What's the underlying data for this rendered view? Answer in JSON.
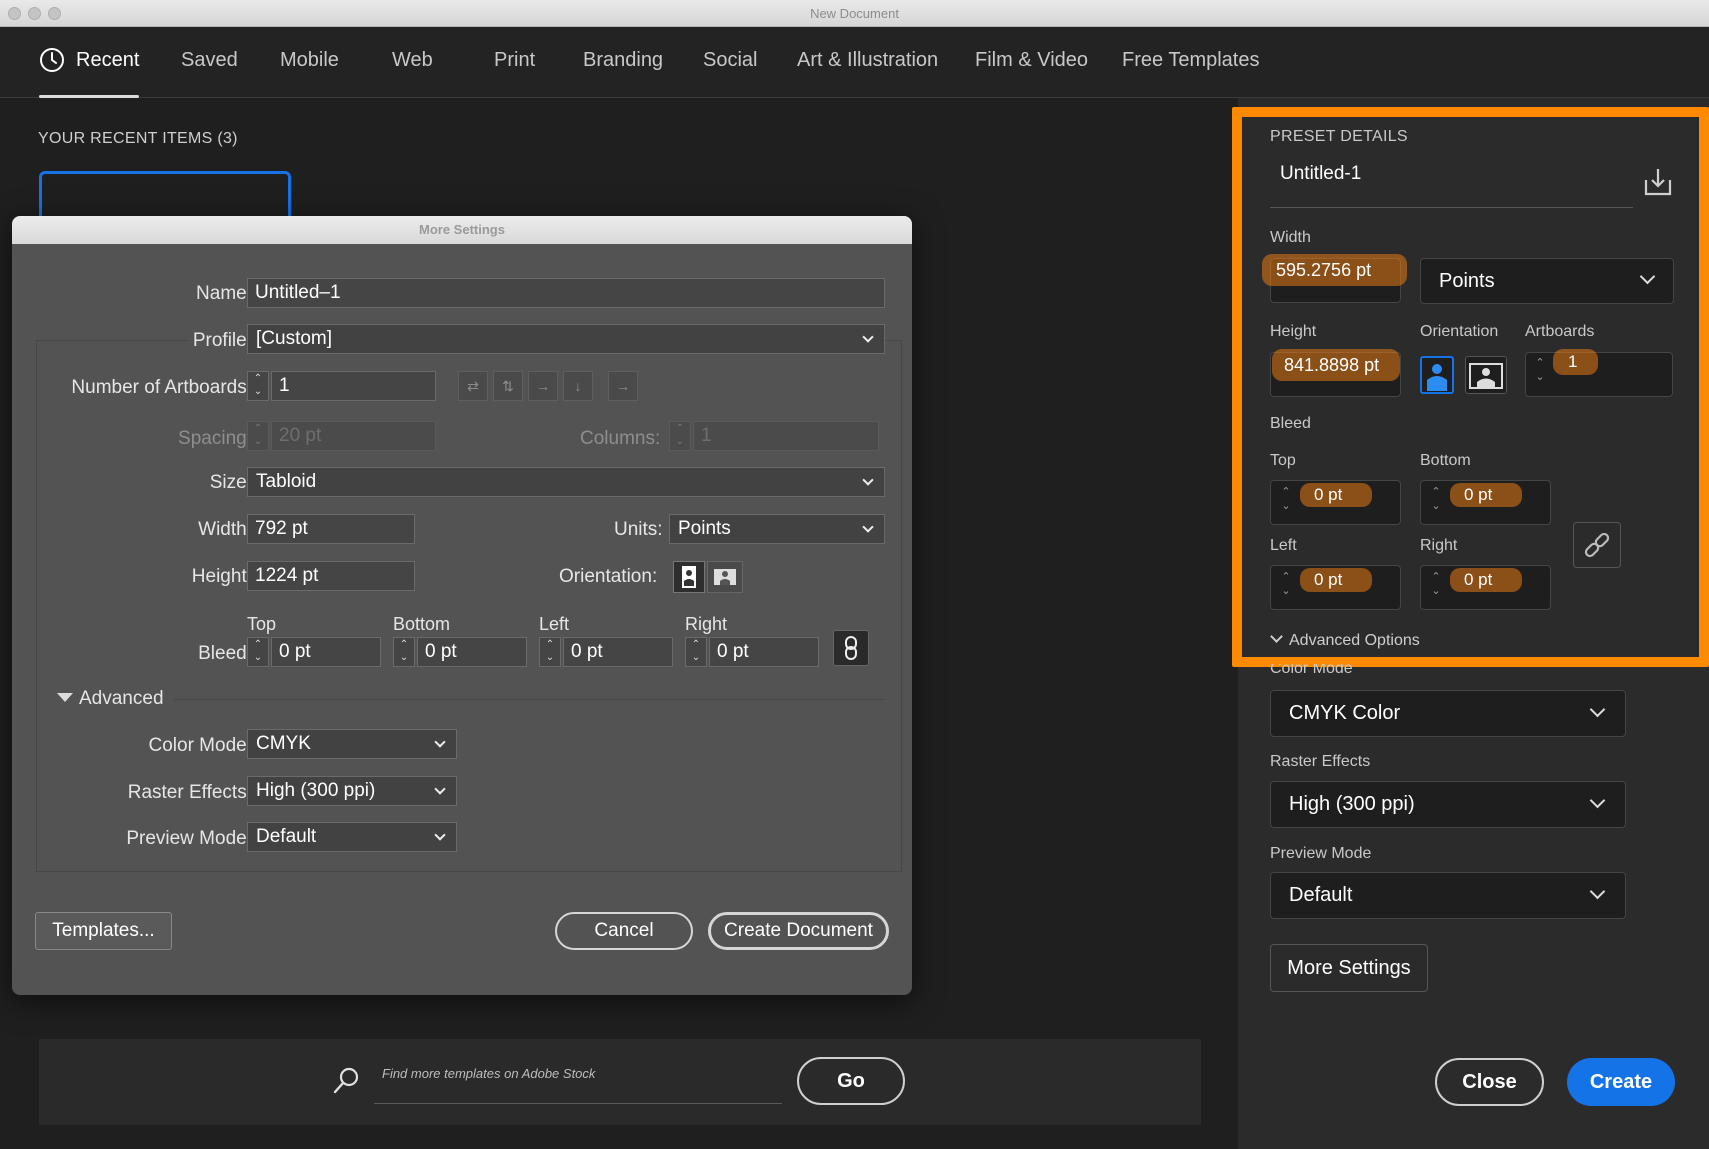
{
  "window": {
    "title": "New Document"
  },
  "tabs": [
    {
      "label": "Recent",
      "icon": "clock-icon"
    },
    {
      "label": "Saved"
    },
    {
      "label": "Mobile"
    },
    {
      "label": "Web"
    },
    {
      "label": "Print"
    },
    {
      "label": "Branding"
    },
    {
      "label": "Social"
    },
    {
      "label": "Art & Illustration"
    },
    {
      "label": "Film & Video"
    },
    {
      "label": "Free Templates"
    }
  ],
  "recent": {
    "heading": "YOUR RECENT ITEMS",
    "count": "(3)"
  },
  "stock": {
    "placeholder": "Find more templates on Adobe Stock",
    "go_label": "Go"
  },
  "preset": {
    "heading": "PRESET DETAILS",
    "name": "Untitled-1",
    "width_label": "Width",
    "width_value": "595.2756 pt",
    "units_value": "Points",
    "height_label": "Height",
    "height_value": "841.8898 pt",
    "orientation_label": "Orientation",
    "artboards_label": "Artboards",
    "artboards_value": "1",
    "bleed_label": "Bleed",
    "top_label": "Top",
    "top_value": "0 pt",
    "bottom_label": "Bottom",
    "bottom_value": "0 pt",
    "left_label": "Left",
    "left_value": "0 pt",
    "right_label": "Right",
    "right_value": "0 pt",
    "advanced_label": "Advanced Options",
    "color_mode_label": "Color Mode",
    "color_mode_value": "CMYK Color",
    "raster_label": "Raster Effects",
    "raster_value": "High (300 ppi)",
    "preview_label": "Preview Mode",
    "preview_value": "Default",
    "more_settings_label": "More Settings",
    "close_label": "Close",
    "create_label": "Create",
    "highlight_color": "#ff8a00",
    "accent_color": "#1473e6"
  },
  "more_settings": {
    "title": "More Settings",
    "name_label": "Name:",
    "name_value": "Untitled–1",
    "profile_label": "Profile:",
    "profile_value": "[Custom]",
    "artboards_label": "Number of Artboards:",
    "artboards_value": "1",
    "spacing_label": "Spacing:",
    "spacing_value": "20 pt",
    "columns_label": "Columns:",
    "columns_value": "1",
    "size_label": "Size:",
    "size_value": "Tabloid",
    "width_label": "Width:",
    "width_value": "792 pt",
    "units_label": "Units:",
    "units_value": "Points",
    "height_label": "Height:",
    "height_value": "1224 pt",
    "orientation_label": "Orientation:",
    "bleed_label": "Bleed:",
    "bleed_top_label": "Top",
    "bleed_bottom_label": "Bottom",
    "bleed_left_label": "Left",
    "bleed_right_label": "Right",
    "bleed_top": "0 pt",
    "bleed_bottom": "0 pt",
    "bleed_left": "0 pt",
    "bleed_right": "0 pt",
    "advanced_label": "Advanced",
    "color_mode_label": "Color Mode:",
    "color_mode_value": "CMYK",
    "raster_label": "Raster Effects:",
    "raster_value": "High (300 ppi)",
    "preview_label": "Preview Mode:",
    "preview_value": "Default",
    "templates_label": "Templates...",
    "cancel_label": "Cancel",
    "create_label": "Create Document"
  }
}
